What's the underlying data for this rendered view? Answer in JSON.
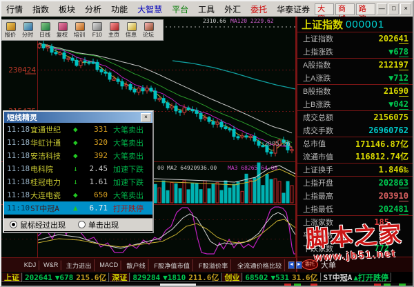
{
  "menu": {
    "items": [
      "行情",
      "指数",
      "板块",
      "分析",
      "功能",
      "大智慧",
      "平台",
      "工具",
      "外汇",
      "委托",
      "华泰证券"
    ]
  },
  "window": {
    "header_buttons": [
      "大赛",
      "商城",
      "路演"
    ],
    "minimize": "—",
    "maximize": "□",
    "close": "×"
  },
  "toolbar": {
    "items": [
      "报价",
      "分时",
      "日线",
      "复权",
      "培训",
      "F10",
      "主页",
      "信息",
      "论坛"
    ]
  },
  "chart": {
    "price_label_1": "230424",
    "price_label_2": "215475",
    "top_ma_1": "2310.66",
    "top_ma_2": "MA120 2229.62",
    "low_label": "2005.26",
    "vol_ma_1": "MA2 64920936.00",
    "vol_ma_2": "MA3 68265264.08",
    "tabs": [
      "KDJ",
      "W&R",
      "主力进出",
      "MACD",
      "散户线",
      "F股净值市值",
      "F股溢价率",
      "全流通价格比较"
    ],
    "tab_left": "◄",
    "tab_right": "►",
    "side_tab": "大单",
    "seal_text": "委托"
  },
  "popup": {
    "title": "短线精灵",
    "rows": [
      {
        "time": "11:18",
        "name": "宜通世纪",
        "marker": "◆",
        "value": "331",
        "action": "大笔卖出"
      },
      {
        "time": "11:18",
        "name": "华虹计通",
        "marker": "◆",
        "value": "320",
        "action": "大笔卖出"
      },
      {
        "time": "11:18",
        "name": "安洁科技",
        "marker": "◆",
        "value": "392",
        "action": "大笔卖出"
      },
      {
        "time": "11:18",
        "name": "电科院",
        "marker": "↓",
        "value": "2.45",
        "action": "加速下跌"
      },
      {
        "time": "11:18",
        "name": "桂冠电力",
        "marker": "↓",
        "value": "1.61",
        "action": "加速下跌"
      },
      {
        "time": "11:18",
        "name": "大连电瓷",
        "marker": "◆",
        "value": "650",
        "action": "大笔卖出"
      },
      {
        "time": "11:10",
        "name": "ST中冠A",
        "marker": "▲",
        "value": "6.71",
        "action": "打开跌停"
      }
    ],
    "options": [
      {
        "label": "鼠标经过出现"
      },
      {
        "label": "单击出现"
      }
    ]
  },
  "panel": {
    "title": "上证指数",
    "code": "000001",
    "rows": [
      {
        "label": "上证指数",
        "value": "2026",
        "tail": "41"
      },
      {
        "label": "上指涨跌",
        "value": "▼6",
        "tail": "78"
      },
      {
        "label": "A股指数",
        "value": "2121",
        "tail": "97"
      },
      {
        "label": "上A涨跌",
        "value": "▼7",
        "tail": "12"
      },
      {
        "label": "B股指数",
        "value": "216",
        "tail": "90"
      },
      {
        "label": "上B涨跌",
        "value": "▼0",
        "tail": "42"
      },
      {
        "label": "成交总额",
        "value": "2156075",
        "tail": ""
      },
      {
        "label": "成交手数",
        "value": "26960762",
        "tail": ""
      },
      {
        "label": "总市值",
        "value": "171146.87亿",
        "tail": ""
      },
      {
        "label": "流通市值",
        "value": "116812.74亿",
        "tail": ""
      },
      {
        "label": "上证换手",
        "value": "1.846‰",
        "tail": ""
      },
      {
        "label": "上指开盘",
        "value": "2028",
        "tail": "63"
      },
      {
        "label": "上指最高",
        "value": "2039",
        "tail": "10"
      },
      {
        "label": "上指最低",
        "value": "2024",
        "tail": "81"
      },
      {
        "label": "上涨家数",
        "value": "185",
        "tail": ""
      },
      {
        "label": "平盘家数",
        "value": "84",
        "tail": ""
      },
      {
        "label": "下跌家数",
        "value": "772",
        "tail": ""
      }
    ]
  },
  "status": {
    "cells": [
      {
        "label": "上证",
        "value": "202641",
        "change": "▼678",
        "amount": "215.6亿"
      },
      {
        "label": "深证",
        "value": "829284",
        "change": "▼1810",
        "amount": "211.6亿"
      },
      {
        "label": "创业",
        "value": "68502",
        "change": "▼531",
        "amount": "31.6亿"
      }
    ],
    "stock_name": "ST中冠A",
    "stock_text": "▲打开跌停"
  },
  "watermark": {
    "line1": "脚本之家",
    "line2": "www.jb51.net"
  }
}
